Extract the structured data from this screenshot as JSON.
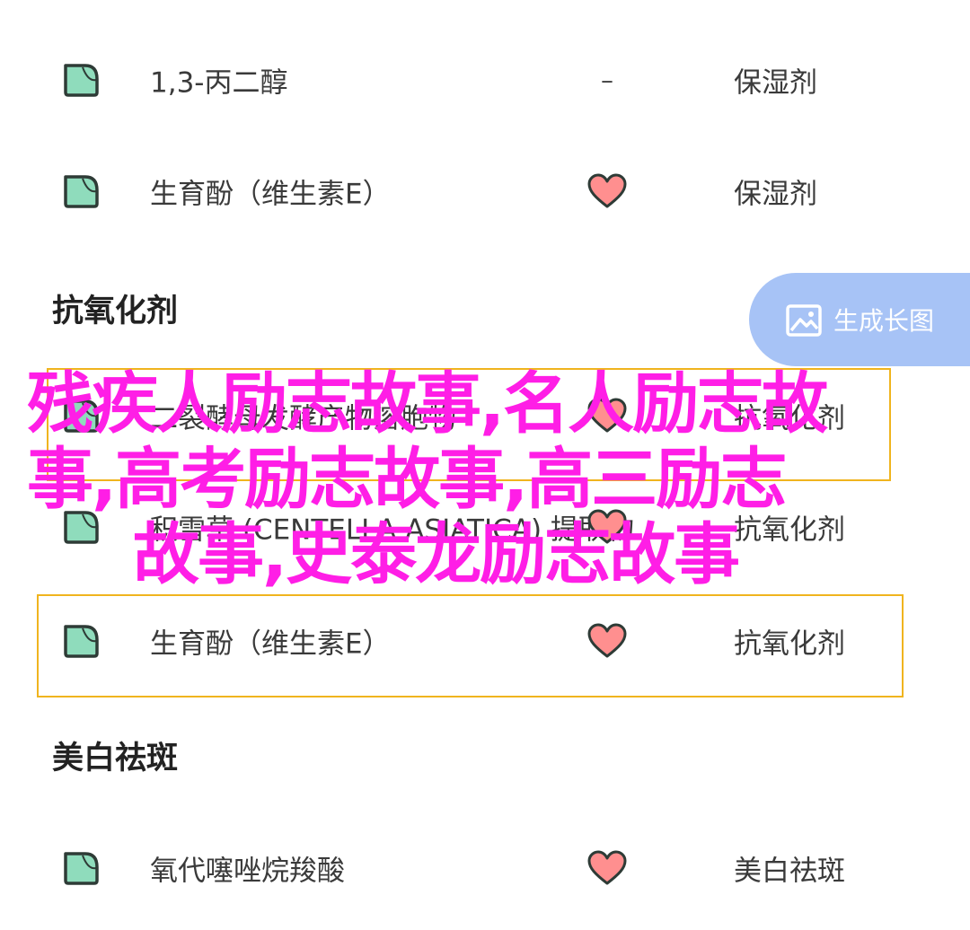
{
  "rows": [
    {
      "name": "1,3-丙二醇",
      "rating_text": "–",
      "effect": "保湿剂",
      "icon": "tag-icon"
    },
    {
      "name": "生育酚（维生素E）",
      "rating_text": "",
      "rating_icon": "heart-icon",
      "effect": "保湿剂",
      "icon": "tag-icon"
    },
    {
      "name": "二裂酵母发酵产物溶胞物",
      "rating_text": "",
      "rating_icon": "heart-icon",
      "effect": "抗氧化剂",
      "icon": "tag-icon"
    },
    {
      "name": "积雪草 (CENTELLA ASIATICA) 提取物",
      "rating_text": "",
      "rating_icon": "heart-icon",
      "effect": "抗氧化剂",
      "icon": "tag-icon"
    },
    {
      "name": "生育酚（维生素E）",
      "rating_text": "",
      "rating_icon": "heart-icon",
      "effect": "抗氧化剂",
      "icon": "tag-icon"
    },
    {
      "name": "氧代噻唑烷羧酸",
      "rating_text": "",
      "rating_icon": "heart-icon",
      "effect": "美白祛斑",
      "icon": "tag-icon"
    }
  ],
  "sections": {
    "antioxidant": "抗氧化剂",
    "whitening": "美白祛斑"
  },
  "generate_button": {
    "label": "生成长图",
    "icon": "image-icon"
  },
  "overlay": {
    "line1": "残疾人励志故事,名人励志故",
    "line2": "事,高考励志故事,高三励志",
    "line3": "故事,史泰龙励志故事"
  },
  "colors": {
    "tag_fill": "#8fdcbc",
    "tag_stroke": "#2e3b36",
    "heart_fill": "#ff8f8f",
    "button_bg": "#a7c3f6",
    "highlight_border": "#f0b41e",
    "overlay_text": "#ff1ee6"
  }
}
